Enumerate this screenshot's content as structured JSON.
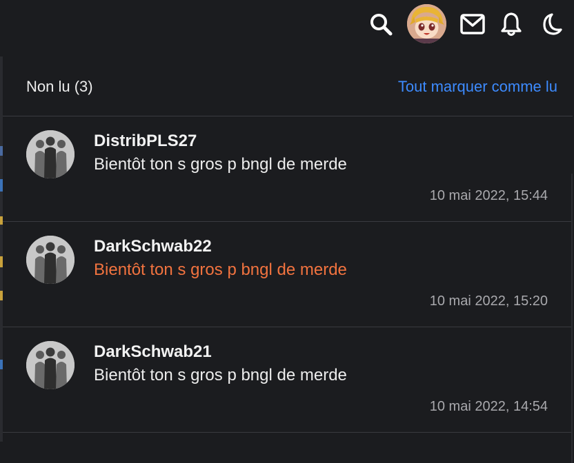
{
  "topbar": {
    "icons": [
      "search-icon",
      "user-avatar",
      "mail-icon",
      "bell-icon",
      "moon-icon"
    ]
  },
  "panel": {
    "unread_label": "Non lu (3)",
    "mark_all_label": "Tout marquer comme lu"
  },
  "notifications": [
    {
      "username": "DistribPLS27",
      "message": "Bientôt ton s gros p bngl de merde",
      "time": "10 mai 2022, 15:44",
      "highlight": false
    },
    {
      "username": "DarkSchwab22",
      "message": "Bientôt ton s gros p bngl de merde",
      "time": "10 mai 2022, 15:20",
      "highlight": true
    },
    {
      "username": "DarkSchwab21",
      "message": "Bientôt ton s gros p bngl de merde",
      "time": "10 mai 2022, 14:54",
      "highlight": false
    }
  ],
  "colors": {
    "background": "#1b1c1f",
    "link": "#3d8bff",
    "highlight_message": "#f2733f",
    "divider": "#3a3b40",
    "timestamp": "#a9a9ad"
  }
}
